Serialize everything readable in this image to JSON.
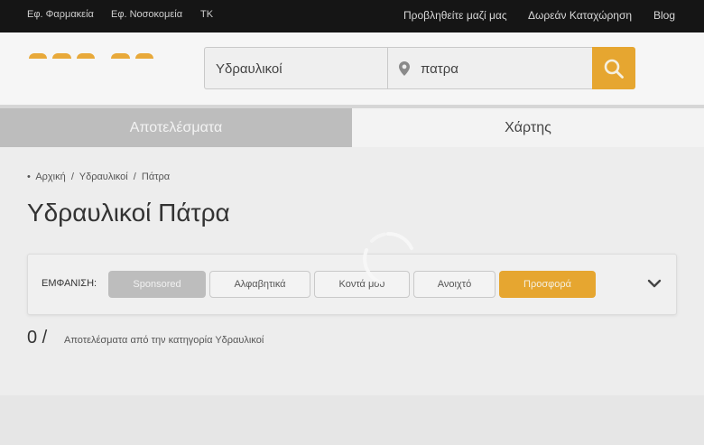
{
  "topbar": {
    "left_links": [
      "Εφ. Φαρμακεία",
      "Εφ. Νοσοκομεία",
      "ΤΚ"
    ],
    "right_links": [
      "Προβληθείτε μαζί μας",
      "Δωρεάν Καταχώρηση",
      "Blog"
    ]
  },
  "search": {
    "what_value": "Υδραυλικοί",
    "where_value": "πατρα",
    "pin_icon": "location-pin-icon",
    "button_icon": "search-icon",
    "accent_color": "#e6a630"
  },
  "tabs": {
    "results": "Αποτελέσματα",
    "map": "Χάρτης"
  },
  "breadcrumb": {
    "bullet": "•",
    "items": [
      "Αρχική",
      "Υδραυλικοί",
      "Πάτρα"
    ],
    "separator": "/"
  },
  "page": {
    "title": "Υδραυλικοί Πάτρα"
  },
  "filters": {
    "label": "ΕΜΦΑΝΙΣΗ:",
    "options": [
      "Sponsored",
      "Αλφαβητικά",
      "Κοντά μου",
      "Ανοιχτό",
      "Προσφορά"
    ],
    "expand_icon": "chevron-down-icon"
  },
  "results": {
    "count": "0 /",
    "label": "Αποτελέσματα από την κατηγορία Υδραυλικοί"
  },
  "loading": {
    "icon": "loading-spinner-icon"
  }
}
